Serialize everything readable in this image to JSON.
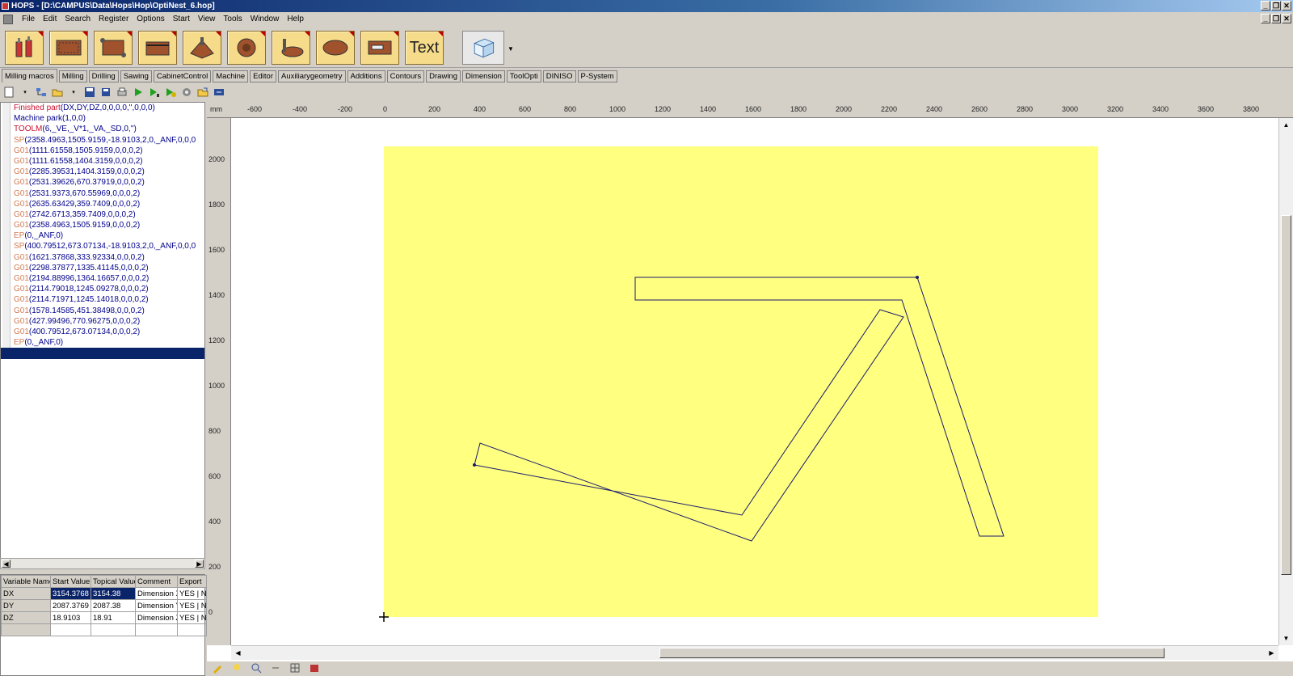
{
  "window": {
    "title": "HOPS - [D:\\CAMPUS\\Data\\Hops\\Hop\\OptiNest_6.hop]",
    "controls": [
      "_",
      "❐",
      "✕"
    ]
  },
  "menu": [
    "File",
    "Edit",
    "Search",
    "Register",
    "Options",
    "Start",
    "View",
    "Tools",
    "Window",
    "Help"
  ],
  "macro_buttons": {
    "text_label": "Text"
  },
  "tabs": [
    "Milling macros",
    "Milling",
    "Drilling",
    "Sawing",
    "CabinetControl",
    "Machine",
    "Editor",
    "Auxiliarygeometry",
    "Additions",
    "Contours",
    "Drawing",
    "Dimension",
    "ToolOpti",
    "DINISO",
    "P-System"
  ],
  "code_lines": [
    {
      "kw": "Finished part",
      "args": "(DX,DY,DZ,0,0,0,0,'',0,0,0)",
      "color": "red"
    },
    {
      "kw": "Machine park",
      "args": "(1,0,0)",
      "color": "blue"
    },
    {
      "kw": "TOOLM",
      "args": "(6,_VE,_V*1,_VA,_SD,0,'')",
      "color": "red"
    },
    {
      "kw": "SP",
      "args": "(2358.4963,1505.9159,-18.9103,2,0,_ANF,0,0,0",
      "color": "brown"
    },
    {
      "kw": "G01",
      "args": "(1111.61558,1505.9159,0,0,0,2)",
      "color": "brown"
    },
    {
      "kw": "G01",
      "args": "(1111.61558,1404.3159,0,0,0,2)",
      "color": "brown"
    },
    {
      "kw": "G01",
      "args": "(2285.39531,1404.3159,0,0,0,2)",
      "color": "brown"
    },
    {
      "kw": "G01",
      "args": "(2531.39626,670.37919,0,0,0,2)",
      "color": "brown"
    },
    {
      "kw": "G01",
      "args": "(2531.9373,670.55969,0,0,0,2)",
      "color": "brown"
    },
    {
      "kw": "G01",
      "args": "(2635.63429,359.7409,0,0,0,2)",
      "color": "brown"
    },
    {
      "kw": "G01",
      "args": "(2742.6713,359.7409,0,0,0,2)",
      "color": "brown"
    },
    {
      "kw": "G01",
      "args": "(2358.4963,1505.9159,0,0,0,2)",
      "color": "brown"
    },
    {
      "kw": "EP",
      "args": "(0,_ANF,0)",
      "color": "brown"
    },
    {
      "kw": "SP",
      "args": "(400.79512,673.07134,-18.9103,2,0,_ANF,0,0,0",
      "color": "brown"
    },
    {
      "kw": "G01",
      "args": "(1621.37868,333.92334,0,0,0,2)",
      "color": "brown"
    },
    {
      "kw": "G01",
      "args": "(2298.37877,1335.41145,0,0,0,2)",
      "color": "brown"
    },
    {
      "kw": "G01",
      "args": "(2194.88996,1364.16657,0,0,0,2)",
      "color": "brown"
    },
    {
      "kw": "G01",
      "args": "(2114.79018,1245.09278,0,0,0,2)",
      "color": "brown"
    },
    {
      "kw": "G01",
      "args": "(2114.71971,1245.14018,0,0,0,2)",
      "color": "brown"
    },
    {
      "kw": "G01",
      "args": "(1578.14585,451.38498,0,0,0,2)",
      "color": "brown"
    },
    {
      "kw": "G01",
      "args": "(427.99496,770.96275,0,0,0,2)",
      "color": "brown"
    },
    {
      "kw": "G01",
      "args": "(400.79512,673.07134,0,0,0,2)",
      "color": "brown"
    },
    {
      "kw": "EP",
      "args": "(0,_ANF,0)",
      "color": "brown"
    }
  ],
  "var_table": {
    "headers": [
      "Variable Name",
      "Start Value",
      "Topical Value",
      "Comment",
      "Export"
    ],
    "rows": [
      [
        "DX",
        "3154.3768",
        "3154.38",
        "Dimension X",
        "YES | N"
      ],
      [
        "DY",
        "2087.3769",
        "2087.38",
        "Dimension Y",
        "YES | N"
      ],
      [
        "DZ",
        "18.9103",
        "18.91",
        "Dimension Z",
        "YES | N"
      ],
      [
        "",
        "",
        "",
        "",
        ""
      ]
    ]
  },
  "ruler": {
    "unit": "mm",
    "x_ticks": [
      "-600",
      "-400",
      "-200",
      "0",
      "200",
      "400",
      "600",
      "800",
      "1000",
      "1200",
      "1400",
      "1600",
      "1800",
      "2000",
      "2200",
      "2400",
      "2600",
      "2800",
      "3000",
      "3200",
      "3400",
      "3600",
      "3800"
    ],
    "y_ticks": [
      "2000",
      "1800",
      "1600",
      "1400",
      "1200",
      "1000",
      "800",
      "600",
      "400",
      "200",
      "0"
    ]
  },
  "colors": {
    "part_fill": "#ffff80",
    "contour": "#1a1a6e",
    "selection": "#0a246a"
  }
}
